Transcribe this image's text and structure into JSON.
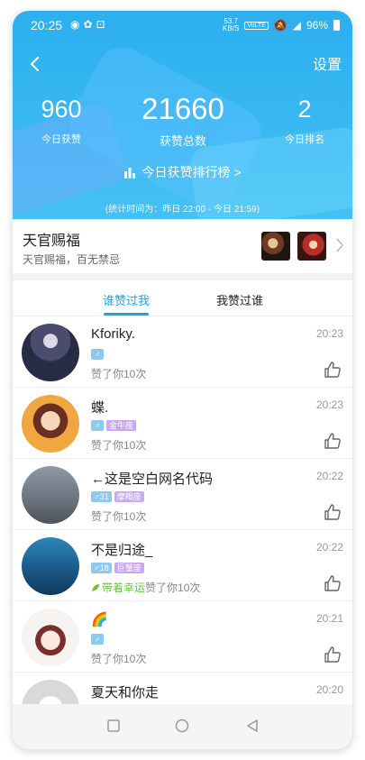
{
  "status": {
    "time": "20:25",
    "speed": "53.7",
    "speed_unit": "KB/S",
    "volte": "VoLTE",
    "battery": "96%"
  },
  "header": {
    "settings_label": "设置",
    "stats": [
      {
        "value": "960",
        "label": "今日获赞"
      },
      {
        "value": "21660",
        "label": "获赞总数"
      },
      {
        "value": "2",
        "label": "今日排名"
      }
    ],
    "rank_link": "今日获赞排行榜 >",
    "period": "(统计时间为：昨日 22:00 - 今日 21:59)"
  },
  "topic": {
    "title": "天官赐福",
    "subtitle": "天官赐福，百无禁忌"
  },
  "tabs": [
    "谁赞过我",
    "我赞过谁"
  ],
  "list": [
    {
      "name": "Kforiky.",
      "time": "20:23",
      "age": "",
      "star": "",
      "desc": "赞了你10次",
      "lucky": ""
    },
    {
      "name": "蝶.",
      "time": "20:23",
      "age": "",
      "star": "金牛座",
      "desc": "赞了你10次",
      "lucky": ""
    },
    {
      "name": "←这是空白网名代码",
      "time": "20:22",
      "age": "31",
      "star": "摩羯座",
      "desc": "赞了你10次",
      "lucky": ""
    },
    {
      "name": "不是归途_",
      "time": "20:22",
      "age": "18",
      "star": "巨蟹座",
      "desc": "赞了你10次",
      "lucky": "带着幸运"
    },
    {
      "name": "🌈",
      "time": "20:21",
      "age": "",
      "star": "",
      "desc": "赞了你10次",
      "lucky": ""
    },
    {
      "name": "夏天和你走",
      "time": "20:20",
      "age": "",
      "star": "",
      "desc": "",
      "lucky": ""
    }
  ],
  "icons": {
    "back": "chevron-left-icon",
    "rank": "bar-chart-icon",
    "like": "thumbs-up-icon",
    "nav": [
      "square-icon",
      "circle-icon",
      "triangle-back-icon"
    ]
  },
  "colors": {
    "accent": "#1aa3ec",
    "header_bg": "#2bb0ee",
    "lucky": "#6cc23e",
    "star_badge": "#c9a7f3",
    "gender_badge": "#8cc9ee"
  }
}
